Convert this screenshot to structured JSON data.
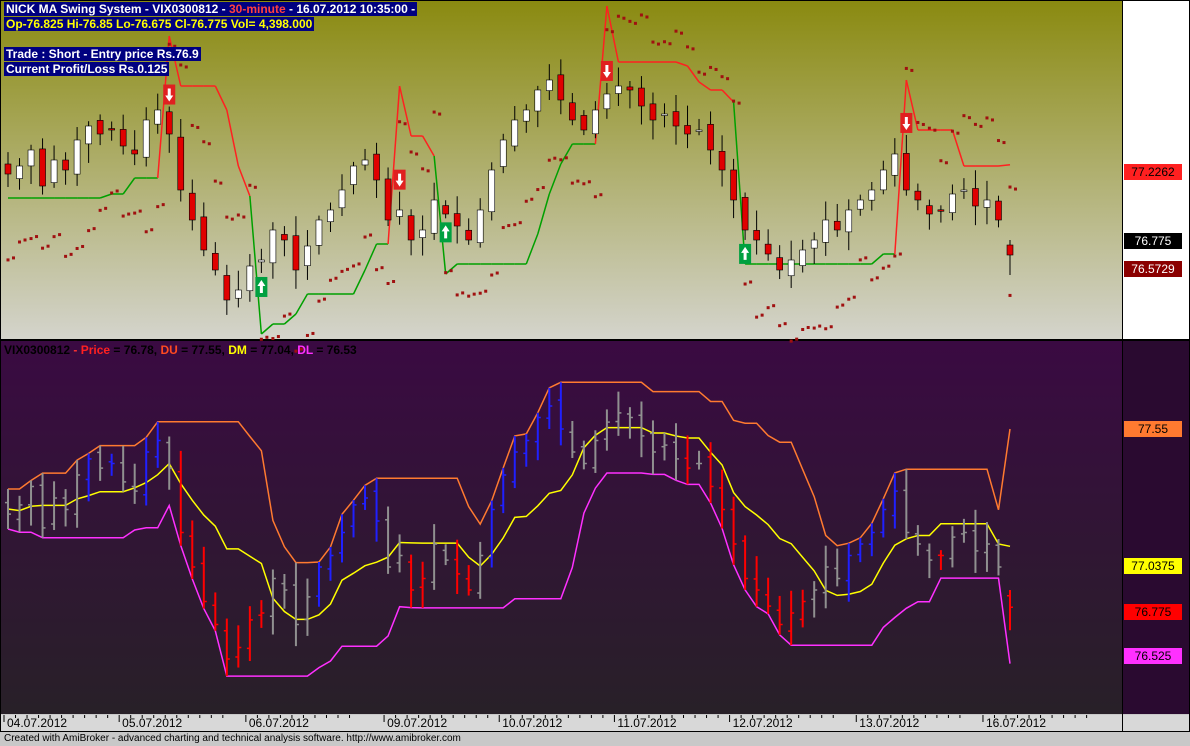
{
  "colors": {
    "upper_bg_top": "#8a8a10",
    "upper_bg_bottom": "#d2d2c8",
    "lower_bg_top": "#3a0a40",
    "lower_bg_bottom": "#2a2030",
    "axis_panel": "#ffffff",
    "candle_up": "#ffffff",
    "candle_down": "#e00000",
    "stop_red": "#ff2020",
    "stop_green": "#00a000",
    "sar_dots": "#a01010",
    "price_blue": "#2020ff",
    "price_gray": "#909090",
    "price_red": "#ff0000",
    "du_line": "#ff7a30",
    "dm_line": "#ffff00",
    "dl_line": "#ff30ff"
  },
  "header": {
    "title_prefix": "NICK MA Swing System - VIX0300812 - ",
    "title_interval": "30-minute",
    "title_suffix": " - 16.07.2012 10:35:00 -",
    "ohlc": "Op-76.825 Hi-76.85 Lo-76.675 Cl-76.775 Vol= 4,398.000",
    "trade": "Trade : Short - Entry price Rs.76.9",
    "pnl": "Current Profit/Loss Rs.0.125"
  },
  "axis_labels_upper": {
    "stop": "77.2262",
    "close": "76.775",
    "sar": "76.5729"
  },
  "legend_lower": {
    "symbol": "VIX0300812",
    "sep": " - ",
    "price_label": "Price",
    "price_value": " = 76.78, ",
    "du_label": "DU",
    "du_value": " = 77.55, ",
    "dm_label": "DM",
    "dm_value": " = 77.04, ",
    "dl_label": "DL",
    "dl_value": " = 76.53"
  },
  "axis_labels_lower": {
    "du": "77.55",
    "dm": "77.0375",
    "price": "76.775",
    "dl": "76.525"
  },
  "footer": "Created with AmiBroker - advanced charting and technical analysis software. http://www.amibroker.com",
  "chart_data": [
    {
      "type": "candlestick",
      "title": "NICK MA Swing System - VIX0300812 - 30-minute",
      "x_ticks": [
        "04.07.2012",
        "05.07.2012",
        "06.07.2012",
        "09.07.2012",
        "10.07.2012",
        "11.07.2012",
        "12.07.2012",
        "13.07.2012",
        "16.07.2012"
      ],
      "last_bar": {
        "open": 76.825,
        "high": 76.85,
        "low": 76.675,
        "close": 76.775,
        "volume": 4398.0
      },
      "trailing_stop_last": 77.2262,
      "sar_last": 76.5729,
      "close_sequence": [
        77.18,
        77.22,
        77.3,
        77.12,
        77.25,
        77.2,
        77.35,
        77.42,
        77.38,
        77.4,
        77.32,
        77.28,
        77.45,
        77.5,
        77.38,
        77.1,
        76.95,
        76.8,
        76.7,
        76.55,
        76.6,
        76.72,
        76.75,
        76.9,
        76.85,
        76.7,
        76.82,
        76.95,
        77.0,
        77.1,
        77.22,
        77.25,
        77.15,
        76.95,
        77.0,
        76.85,
        76.9,
        77.05,
        76.98,
        76.92,
        76.85,
        77.0,
        77.2,
        77.35,
        77.45,
        77.5,
        77.6,
        77.65,
        77.55,
        77.45,
        77.4,
        77.5,
        77.58,
        77.62,
        77.6,
        77.52,
        77.45,
        77.48,
        77.42,
        77.38,
        77.4,
        77.3,
        77.2,
        77.05,
        76.9,
        76.85,
        76.78,
        76.7,
        76.75,
        76.8,
        76.85,
        76.95,
        76.9,
        77.0,
        77.05,
        77.1,
        77.2,
        77.28,
        77.1,
        77.05,
        76.98,
        77.0,
        77.08,
        77.1,
        77.02,
        77.05,
        76.95,
        76.78
      ],
      "signals": [
        {
          "type": "sell",
          "bar": 14
        },
        {
          "type": "buy",
          "bar": 22
        },
        {
          "type": "sell",
          "bar": 34
        },
        {
          "type": "buy",
          "bar": 38
        },
        {
          "type": "sell",
          "bar": 52
        },
        {
          "type": "buy",
          "bar": 64
        },
        {
          "type": "sell",
          "bar": 78
        }
      ]
    },
    {
      "type": "line",
      "title": "VIX0300812",
      "series": [
        {
          "name": "Price",
          "last": 76.78
        },
        {
          "name": "DU",
          "last": 77.55
        },
        {
          "name": "DM",
          "last": 77.04
        },
        {
          "name": "DL",
          "last": 76.53
        }
      ]
    }
  ]
}
